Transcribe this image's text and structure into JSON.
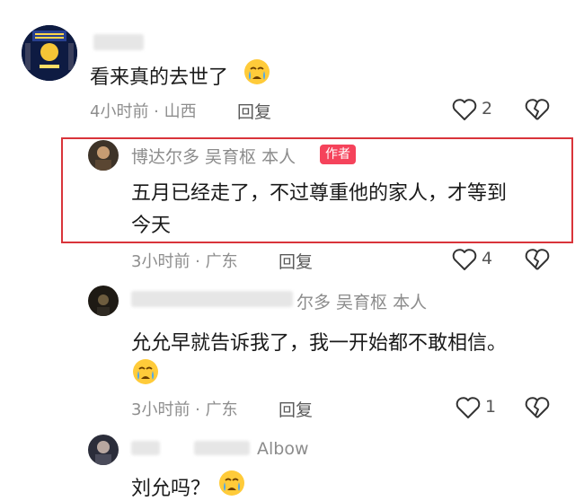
{
  "comments": [
    {
      "author_suffix": "",
      "text": "看来真的去世了",
      "time_location": "4小时前 · 山西",
      "reply": "回复",
      "likes": "2"
    },
    {
      "author": "博达尔多 吴育枢 本人",
      "badge": "作者",
      "text_line1": "五月已经走了，不过尊重他的家人，才等到",
      "text_line2": "今天",
      "time_location": "3小时前 · 广东",
      "reply": "回复",
      "likes": "4"
    },
    {
      "author_suffix": "尔多 吴育枢 本人",
      "text": "允允早就告诉我了，我一开始都不敢相信。",
      "time_location": "3小时前 · 广东",
      "reply": "回复",
      "likes": "1"
    },
    {
      "author_suffix": "Albow",
      "text": "刘允吗？"
    }
  ],
  "icons": {
    "like": "heart-outline-icon",
    "dislike": "broken-heart-icon",
    "emoji": "crying-face-emoji"
  },
  "colors": {
    "highlight_border": "#d9343a",
    "author_badge": "#f5435b"
  }
}
